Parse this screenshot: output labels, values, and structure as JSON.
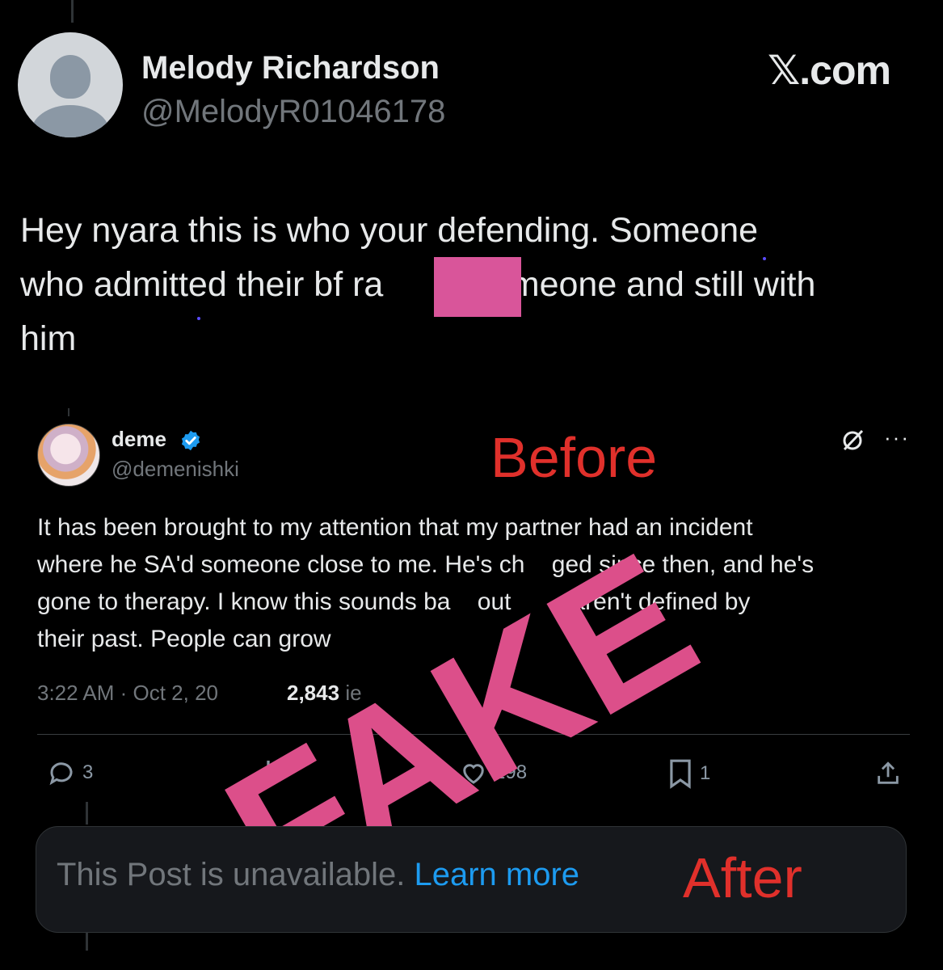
{
  "header": {
    "display_name": "Melody Richardson",
    "handle": "@MelodyR01046178",
    "brand": "𝕏.com"
  },
  "post": {
    "text_line1": "Hey nyara this is who your defending. Someone",
    "text_line2_a": "who admitted their bf ra",
    "text_line2_b": "someone and still with",
    "text_line3": "him"
  },
  "quoted": {
    "display_name": "deme",
    "handle": "@demenishki",
    "label_before": "Before",
    "text_line1": "It has been brought to my attention that my partner had an incident",
    "text_line2": "where he SA'd someone close to me. He's ch    ged since then, and he's",
    "text_line3": "gone to therapy. I know this sounds ba    out         aren't defined by",
    "text_line4": "their past. People can grow",
    "meta": "3:22 AM · Oct 2, 20",
    "views": "2,843",
    "views_tail": "ie",
    "actions": {
      "replies": "3",
      "likes": "198",
      "bookmarks": "1"
    }
  },
  "overlay": {
    "stamp": "FAKE"
  },
  "unavailable": {
    "text": "This Post is unavailable.",
    "link": "Learn more",
    "label_after": "After"
  },
  "colors": {
    "background": "#000000",
    "stamp": "#dc4f8a",
    "annotation": "#e0302b",
    "link": "#1d9bf0",
    "muted": "#71767b"
  }
}
